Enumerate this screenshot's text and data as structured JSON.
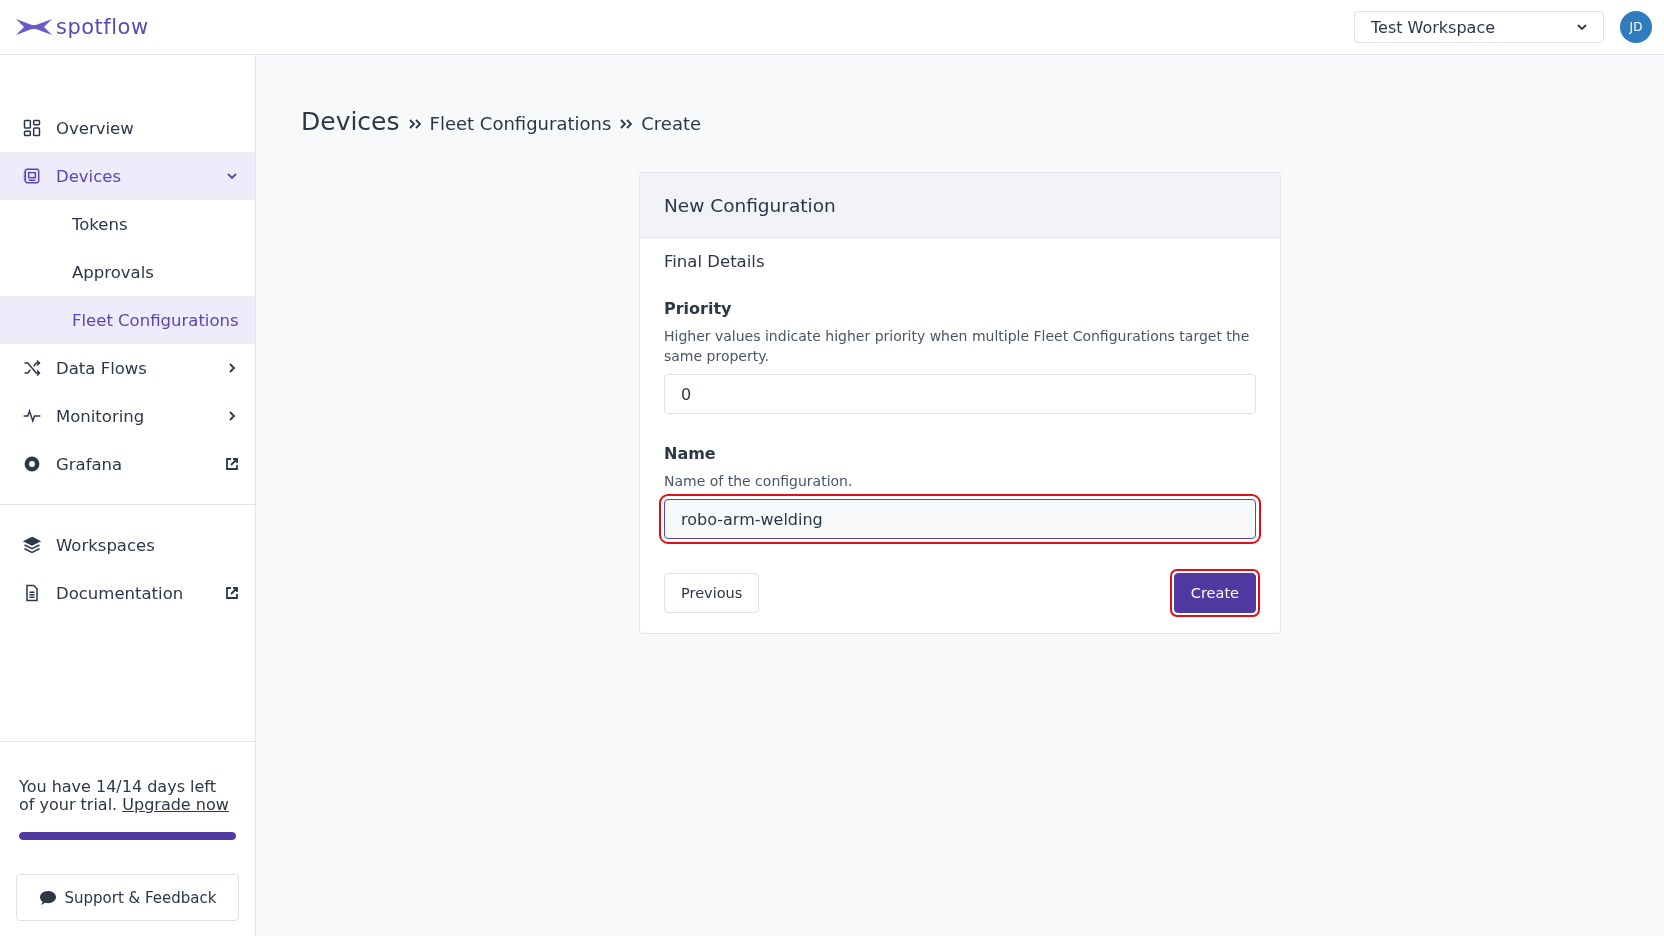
{
  "header": {
    "logo": "spotflow",
    "workspace_selector": "Test Workspace",
    "avatar": "JD"
  },
  "sidebar": {
    "nav": [
      {
        "label": "Overview",
        "selected": false
      },
      {
        "label": "Devices",
        "selected": true,
        "expanded": true,
        "children": [
          {
            "label": "Tokens",
            "selected": false
          },
          {
            "label": "Approvals",
            "selected": false
          },
          {
            "label": "Fleet Configurations",
            "selected": true
          }
        ]
      },
      {
        "label": "Data Flows",
        "selected": false,
        "expanded": false
      },
      {
        "label": "Monitoring",
        "selected": false,
        "expanded": false
      },
      {
        "label": "Grafana",
        "selected": false,
        "external": true
      }
    ],
    "secondary": [
      {
        "label": "Workspaces",
        "selected": false
      },
      {
        "label": "Documentation",
        "selected": false,
        "external": true
      }
    ],
    "trial": {
      "text": "You have 14/14 days left of your trial.",
      "link": "Upgrade now",
      "level": 1
    },
    "support_button": "Support & Feedback"
  },
  "breadcrumb": [
    "Devices",
    "Fleet Configurations",
    "Create"
  ],
  "card": {
    "title": "New Configuration",
    "step": "Final Details",
    "fields": [
      {
        "label": "Priority",
        "help": "Higher values indicate higher priority when multiple Fleet Configurations target the same property.",
        "value": "0",
        "highlighted": false
      },
      {
        "label": "Name",
        "help": "Name of the configuration.",
        "value": "robo-arm-welding",
        "highlighted": true
      }
    ],
    "buttons": [
      {
        "label": "Previous",
        "kind": "secondary",
        "highlighted": false
      },
      {
        "label": "Create",
        "kind": "primary",
        "highlighted": true
      }
    ]
  }
}
